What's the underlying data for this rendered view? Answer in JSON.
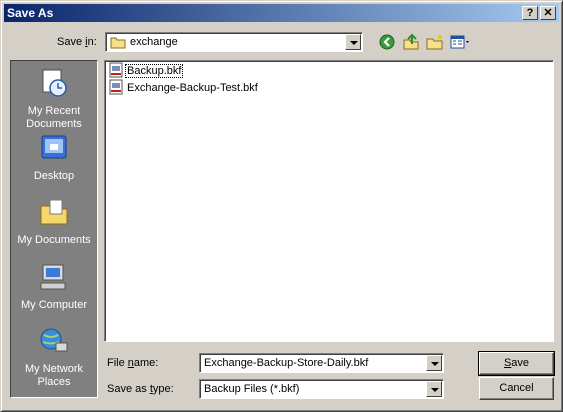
{
  "window": {
    "title": "Save As",
    "help_label": "?",
    "close_label": "✕"
  },
  "save_in": {
    "label_pre": "Save ",
    "label_ul": "i",
    "label_post": "n:",
    "value": "exchange"
  },
  "toolbar": {
    "icons": [
      "back-icon",
      "up-folder-icon",
      "new-folder-icon",
      "views-menu-icon"
    ]
  },
  "places": [
    {
      "label": "My Recent Documents",
      "icon": "recent-documents-icon"
    },
    {
      "label": "Desktop",
      "icon": "desktop-icon"
    },
    {
      "label": "My Documents",
      "icon": "my-documents-icon"
    },
    {
      "label": "My Computer",
      "icon": "my-computer-icon"
    },
    {
      "label": "My Network Places",
      "icon": "network-places-icon"
    }
  ],
  "files": [
    {
      "name": "Backup.bkf"
    },
    {
      "name": "Exchange-Backup-Test.bkf"
    }
  ],
  "filename": {
    "label_pre": "File ",
    "label_ul": "n",
    "label_post": "ame:",
    "value": "Exchange-Backup-Store-Daily.bkf"
  },
  "filetype": {
    "label_pre": "Save as ",
    "label_ul": "t",
    "label_post": "ype:",
    "value": "Backup Files (*.bkf)"
  },
  "buttons": {
    "save_ul": "S",
    "save_post": "ave",
    "cancel": "Cancel"
  },
  "colors": {
    "title_start": "#0a246a",
    "title_end": "#a6caf0",
    "face": "#d4d0c8",
    "places_bg": "#808080"
  }
}
